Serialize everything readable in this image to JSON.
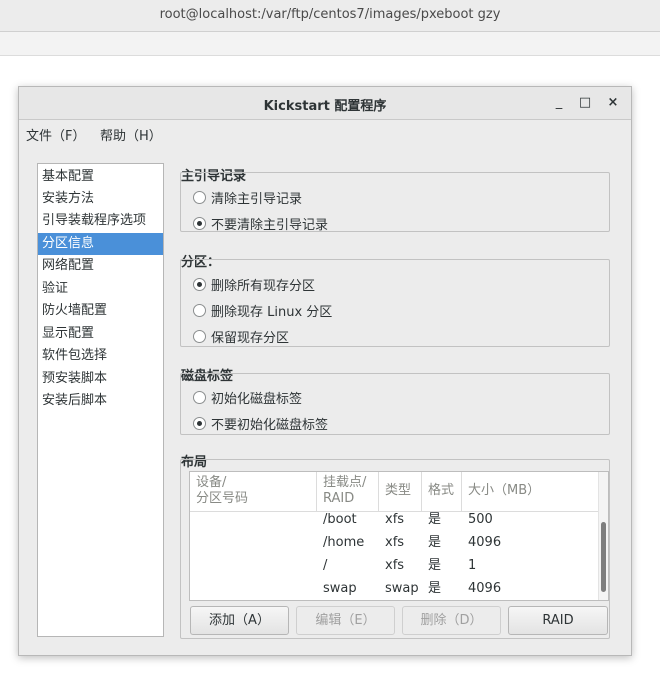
{
  "terminal": {
    "title": "root@localhost:/var/ftp/centos7/images/pxeboot   gzy"
  },
  "window": {
    "title": "Kickstart 配置程序",
    "controls": {
      "minimize": "_",
      "maximize": "□",
      "close": "×"
    }
  },
  "menubar": {
    "file": "文件（F）",
    "help": "帮助（H）"
  },
  "sidebar": {
    "items": [
      {
        "label": "基本配置",
        "selected": false
      },
      {
        "label": "安装方法",
        "selected": false
      },
      {
        "label": "引导装载程序选项",
        "selected": false
      },
      {
        "label": "分区信息",
        "selected": true
      },
      {
        "label": "网络配置",
        "selected": false
      },
      {
        "label": "验证",
        "selected": false
      },
      {
        "label": "防火墙配置",
        "selected": false
      },
      {
        "label": "显示配置",
        "selected": false
      },
      {
        "label": "软件包选择",
        "selected": false
      },
      {
        "label": "预安装脚本",
        "selected": false
      },
      {
        "label": "安装后脚本",
        "selected": false
      }
    ]
  },
  "mbr": {
    "label": "主引导记录",
    "options": [
      {
        "label": "清除主引导记录",
        "checked": false
      },
      {
        "label": "不要清除主引导记录",
        "checked": true
      }
    ]
  },
  "partitions": {
    "label": "分区：",
    "options": [
      {
        "label": "删除所有现存分区",
        "checked": true
      },
      {
        "label": "删除现存  Linux 分区",
        "checked": false
      },
      {
        "label": "保留现存分区",
        "checked": false
      }
    ]
  },
  "disklabel": {
    "label": "磁盘标签",
    "options": [
      {
        "label": "初始化磁盘标签",
        "checked": false
      },
      {
        "label": "不要初始化磁盘标签",
        "checked": true
      }
    ]
  },
  "layout": {
    "label": "布局",
    "headers": {
      "device_line1": "设备/",
      "device_line2": "分区号码",
      "mount_line1": "挂载点/",
      "mount_line2": "RAID",
      "type": "类型",
      "format": "格式",
      "size": "大小（MB）"
    },
    "rows": [
      {
        "device": "",
        "mount": "/boot",
        "type": "xfs",
        "format": "是",
        "size": "500"
      },
      {
        "device": "",
        "mount": "/home",
        "type": "xfs",
        "format": "是",
        "size": "4096"
      },
      {
        "device": "",
        "mount": "/",
        "type": "xfs",
        "format": "是",
        "size": "1"
      },
      {
        "device": "",
        "mount": "swap",
        "type": "swap",
        "format": "是",
        "size": "4096"
      }
    ]
  },
  "buttons": {
    "add": "添加（A）",
    "edit": "编辑（E）",
    "delete": "删除（D）",
    "raid": "RAID"
  },
  "colors": {
    "selection": "#4a90d9",
    "window_bg": "#ececec"
  }
}
